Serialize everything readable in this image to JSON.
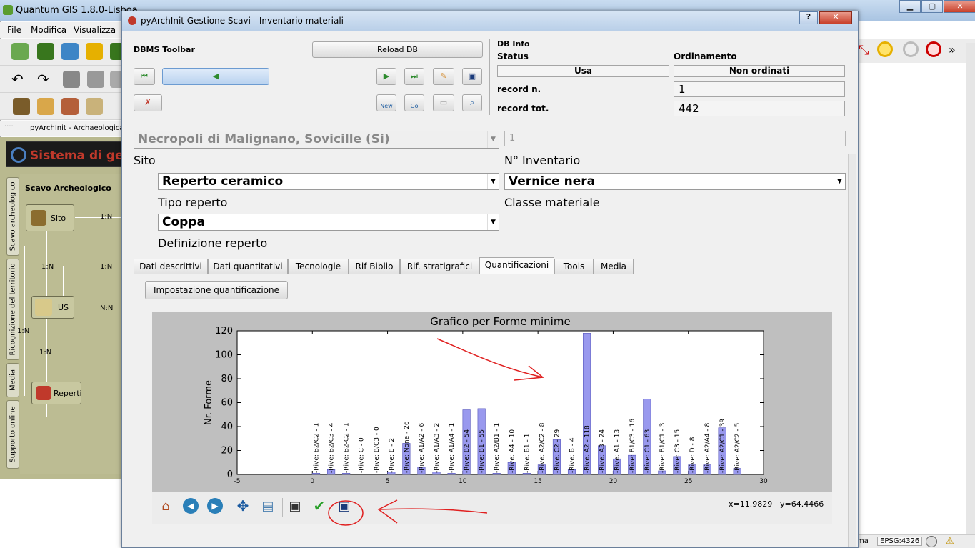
{
  "qgis": {
    "title": "Quantum GIS 1.8.0-Lisboa",
    "menu": [
      "File",
      "Modifica",
      "Visualizza"
    ],
    "plugin_toolbar_label": "pyArchInit - Archaeological Da",
    "panel_title": "Sistema di gestio",
    "flow_title": "Scavo Archeologico",
    "vertical_tabs": [
      "Scavo archeologico",
      "Ricognizione del territorio",
      "Media",
      "Supporto online"
    ],
    "flow_nodes": [
      "Sito",
      "US",
      "Reperti"
    ],
    "flow_labels": [
      "1:N",
      "1:N",
      "1:N",
      "N:N",
      "1:N",
      "1:N"
    ],
    "status_crs": "EPSG:4326",
    "status_partial": "ma"
  },
  "dialog": {
    "title": "pyArchInit Gestione Scavi - Inventario materiali",
    "dbms_toolbar_label": "DBMS Toolbar",
    "reload_button": "Reload DB",
    "btn_new": "New",
    "btn_go": "Go",
    "db_info": {
      "header": "DB Info",
      "status_label": "Status",
      "ordering_label": "Ordinamento",
      "status_value": "Usa",
      "ordering_value": "Non ordinati",
      "record_n_label": "record n.",
      "record_n_value": "1",
      "record_tot_label": "record tot.",
      "record_tot_value": "442"
    },
    "form": {
      "site_value": "Necropoli di Malignano, Sovicille (Si)",
      "inventory_value": "1",
      "site_label": "Sito",
      "inventory_label": "N° Inventario",
      "tipo_value": "Reperto ceramico",
      "classe_value": "Vernice nera",
      "tipo_label": "Tipo reperto",
      "classe_label": "Classe materiale",
      "definizione_value": "Coppa",
      "definizione_label": "Definizione reperto"
    },
    "tabs": [
      "Dati descrittivi",
      "Dati quantitativi",
      "Tecnologie",
      "Rif Biblio",
      "Rif. stratigrafici",
      "Quantificazioni",
      "Tools",
      "Media"
    ],
    "active_tab": "Quantificazioni",
    "quant_button": "Impostazione quantificazione",
    "coords": {
      "x": "x=11.9829",
      "y": "y=64.4466"
    }
  },
  "chart_data": {
    "type": "bar",
    "title": "Grafico per Forme minime",
    "ylabel": "Nr. Forme",
    "xlabel": "",
    "xlim": [
      -5,
      30
    ],
    "ylim": [
      0,
      120
    ],
    "xticks": [
      "-5",
      "0",
      "5",
      "10",
      "15",
      "20",
      "25",
      "30"
    ],
    "yticks": [
      "0",
      "20",
      "40",
      "60",
      "80",
      "100",
      "120"
    ],
    "bar_color": "#9999ee",
    "x": [
      0,
      1,
      2,
      3,
      4,
      5,
      6,
      7,
      8,
      9,
      10,
      11,
      12,
      13,
      14,
      15,
      16,
      17,
      18,
      19,
      20,
      21,
      22,
      23,
      24,
      25,
      26,
      27,
      28
    ],
    "values": [
      1,
      4,
      1,
      0,
      0,
      2,
      26,
      6,
      2,
      1,
      54,
      55,
      1,
      10,
      1,
      8,
      29,
      4,
      118,
      24,
      13,
      16,
      63,
      3,
      15,
      8,
      8,
      39,
      5
    ],
    "labels": [
      "-Rive: B2/C2 - 1",
      "-Rive: B2/C3 - 4",
      "-Rive: B2-C2 - 1",
      "-Rive: C - 0",
      "-Rive: B/C3 - 0",
      "-Rive: E - 2",
      "-Rive: None - 26",
      "-Rive: A1/A2 - 6",
      "-Rive: A1/A3 - 2",
      "-Rive: A1/A4 - 1",
      "-Rive: B2 - 54",
      "-Rive: B1 - 55",
      "-Rive: A2/B1 - 1",
      "-Rive: A4 - 10",
      "-Rive: B1 - 1",
      "-Rive: A2/C2 - 8",
      "-Rive: C2 - 29",
      "-Rive: B - 4",
      "-Rive: A2 - 118",
      "-Rive: A3 - 24",
      "-Rive: A1 - 13",
      "-Rive: B1/C3 - 16",
      "-Rive: C1 - 63",
      "-Rive: B1/C1 - 3",
      "-Rive: C3 - 15",
      "-Rive: D - 8",
      "-Rive: A2/A4 - 8",
      "-Rive: A2/C1 - 39",
      "-Rive: A2/C2 - 5"
    ]
  },
  "annotation_color": "#e02020"
}
